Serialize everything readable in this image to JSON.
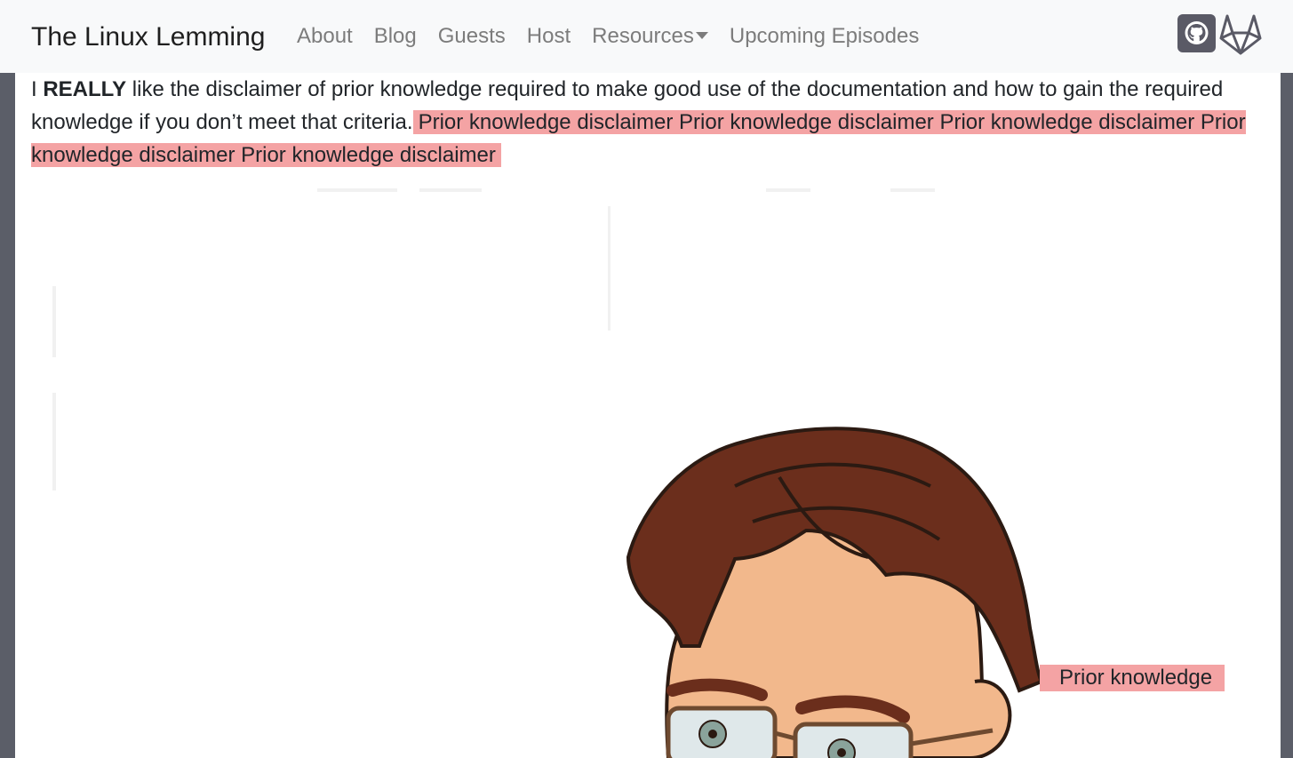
{
  "navbar": {
    "brand": "The Linux Lemming",
    "links": [
      "About",
      "Blog",
      "Guests",
      "Host",
      "Resources",
      "Upcoming Episodes"
    ],
    "icons": [
      "github-icon",
      "gitlab-icon"
    ]
  },
  "content": {
    "paragraph": {
      "lead": "I ",
      "emphasis": "REALLY",
      "rest": " like the disclaimer of prior knowledge required to make good use of the documentation and how to gain the required knowledge if you don’t meet that criteria.",
      "highlight": "Prior knowledge disclaimer Prior knowledge disclaimer Prior knowledge disclaimer Prior knowledge disclaimer Prior knowledge disclaimer"
    },
    "side_highlight": "Prior knowledge"
  },
  "colors": {
    "navbar_bg": "#f8f9fa",
    "page_bg": "#5b5e68",
    "highlight": "#f4a3a4",
    "hair": "#6b2e1c",
    "skin": "#f2b88c"
  }
}
